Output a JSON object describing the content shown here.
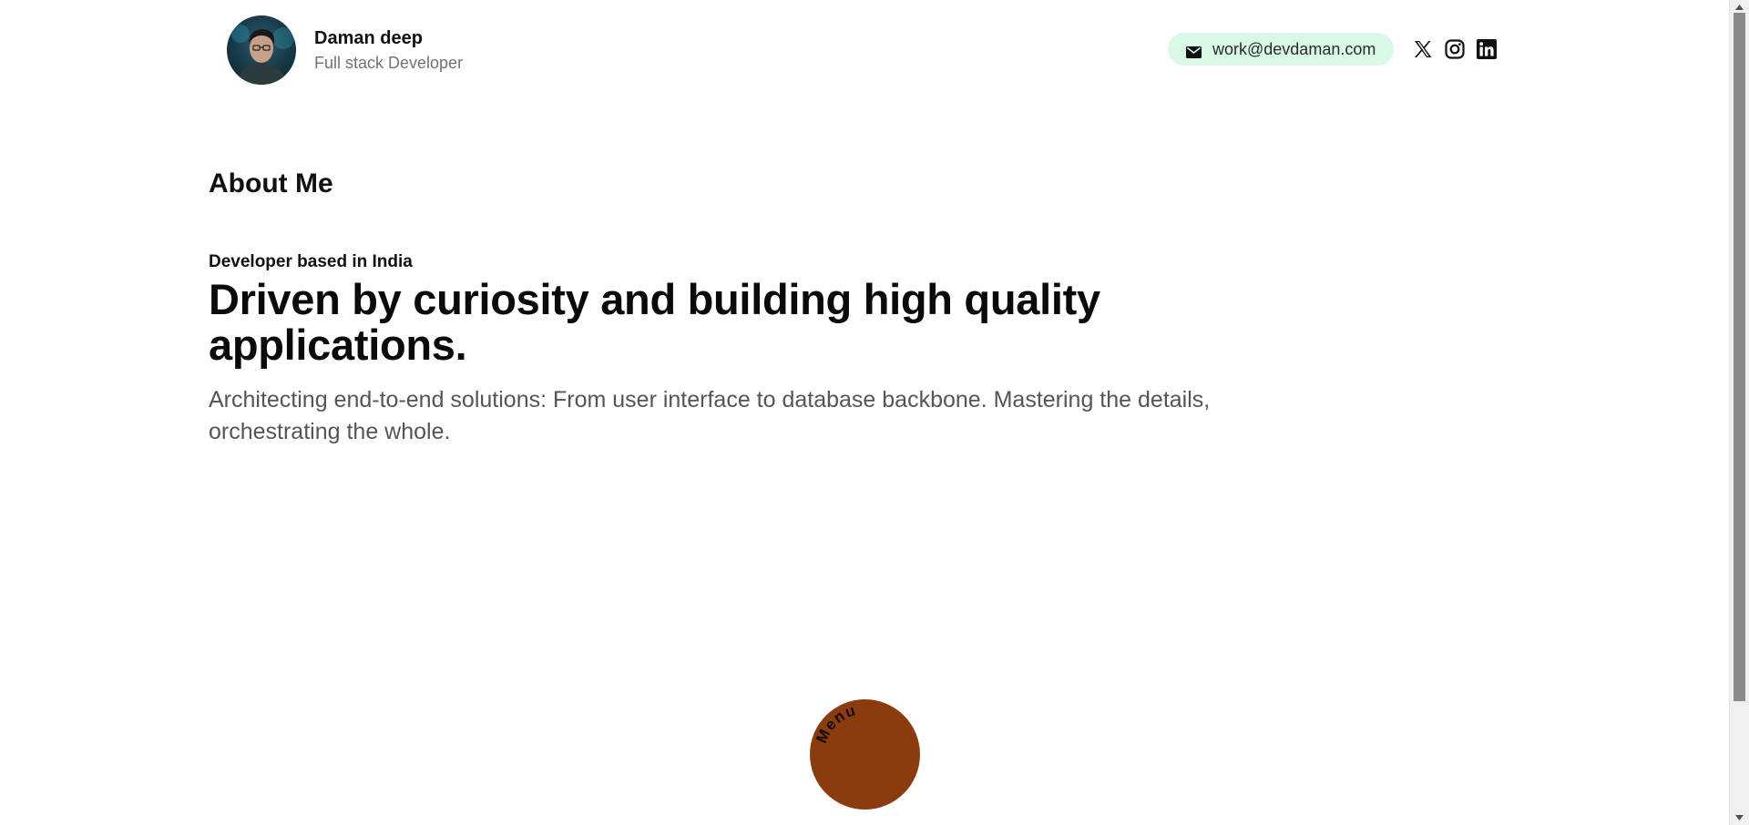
{
  "profile": {
    "name": "Daman deep",
    "role": "Full stack Developer",
    "avatar_icon": "avatar-portrait"
  },
  "contact": {
    "email": "work@devdaman.com",
    "email_icon": "mail-icon",
    "pill_color": "#d9f8e6",
    "socials": [
      {
        "name": "x-icon"
      },
      {
        "name": "instagram-icon"
      },
      {
        "name": "linkedin-icon"
      }
    ]
  },
  "about": {
    "title": "About Me",
    "eyebrow": "Developer based in India",
    "headline": "Driven by curiosity and building high quality applications.",
    "lead": "Architecting end-to-end solutions: From user interface to database backbone. Mastering the details, orchestrating the whole."
  },
  "menu": {
    "label": "Menu",
    "color": "#8b3c0f"
  }
}
